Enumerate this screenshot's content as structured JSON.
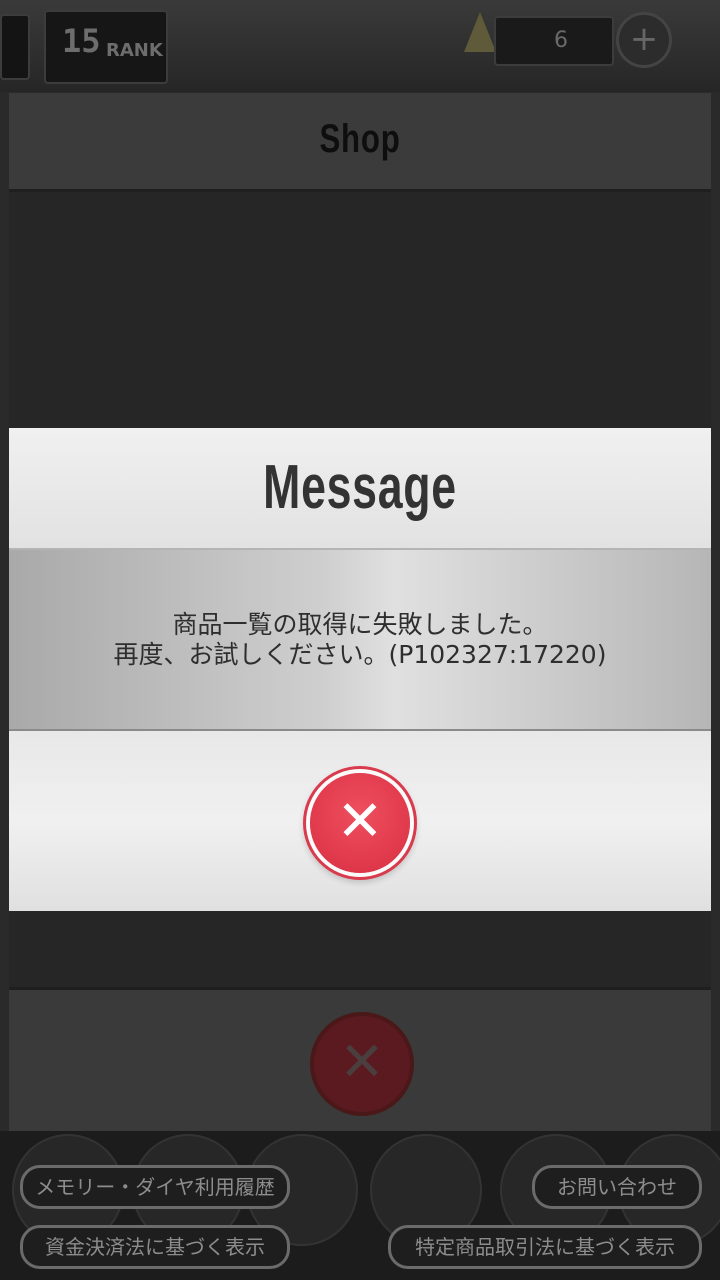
{
  "status_bar": {
    "rank_number": "15",
    "rank_label": "RANK",
    "player_name": "　　　",
    "currency_value": "6",
    "plus_symbol": "+"
  },
  "shop": {
    "title": "Shop",
    "close_symbol": "✕"
  },
  "dialog": {
    "title": "Message",
    "message_line1": "商品一覧の取得に失敗しました。",
    "message_line2": "再度、お試しください。(P102327:17220)",
    "close_symbol": "✕"
  },
  "links": {
    "memory_diamond_history": "メモリー・ダイヤ利用履歴",
    "contact": "お問い合わせ",
    "payment_services_act": "資金決済法に基づく表示",
    "specified_commercial_transactions": "特定商品取引法に基づく表示"
  },
  "colors": {
    "accent_red": "#e0384b",
    "dialog_light": "#ececec",
    "overlay_dark": "#262626"
  },
  "icons": [
    "plus-icon",
    "gem-icon",
    "close-icon"
  ]
}
